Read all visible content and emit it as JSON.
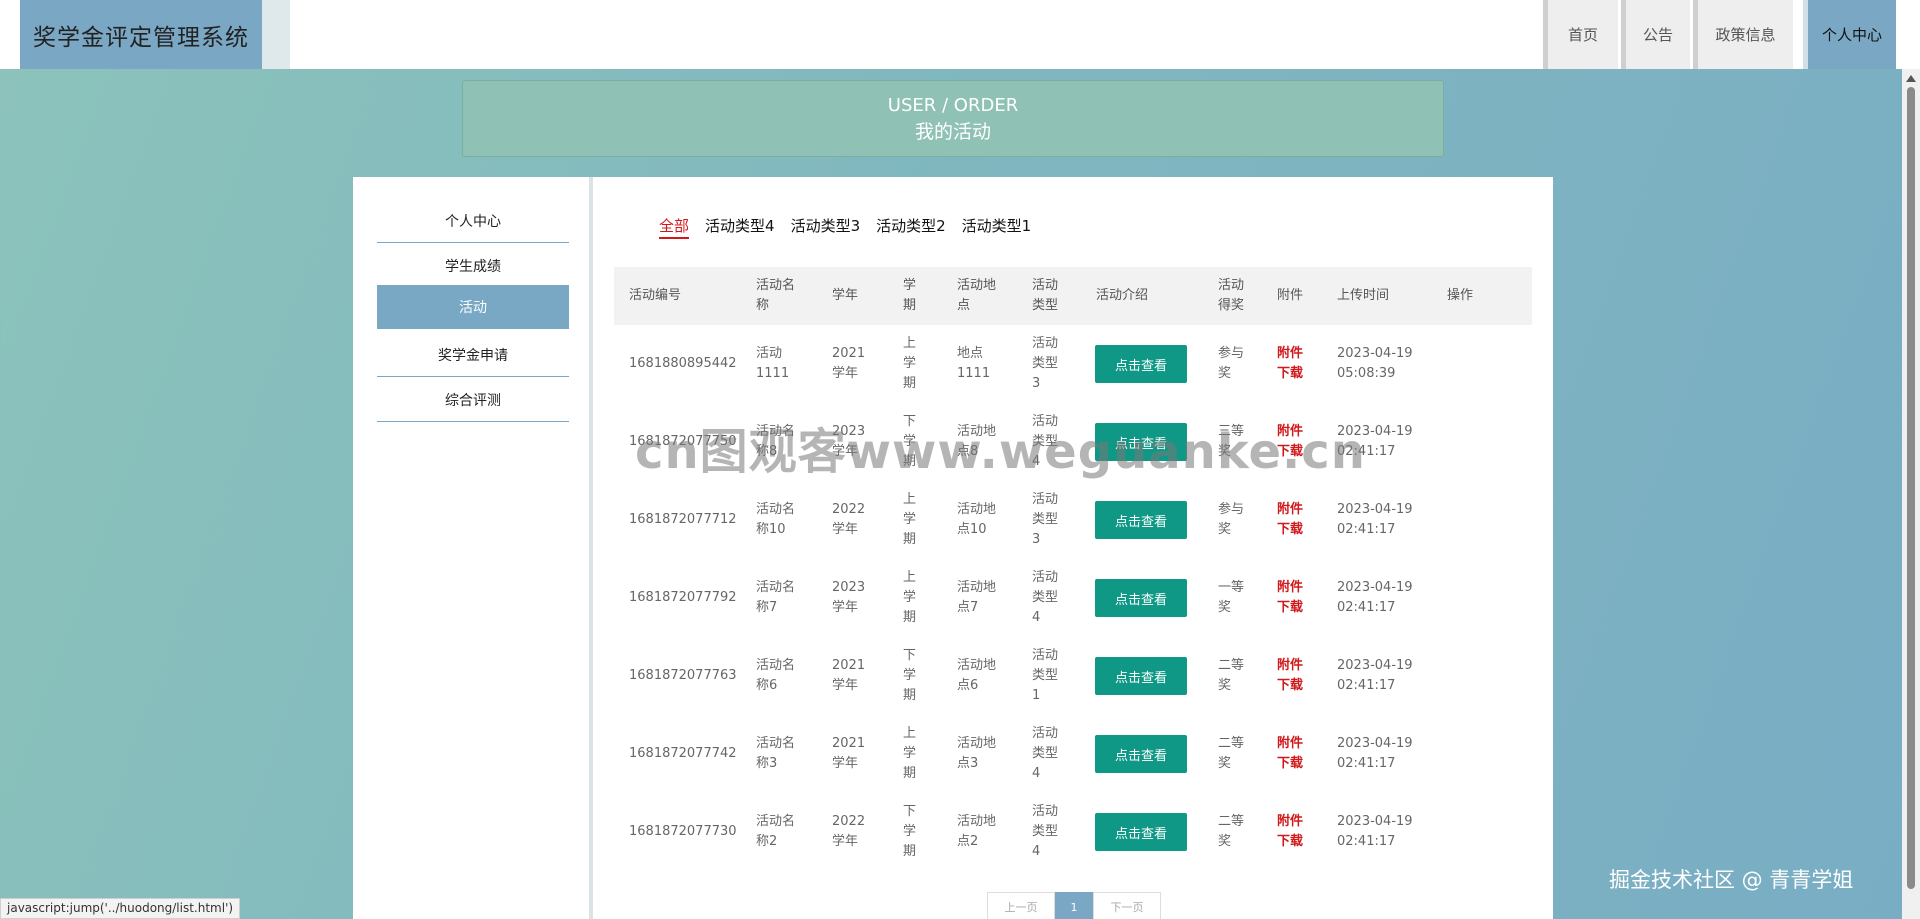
{
  "app_title": "奖学金评定管理系统",
  "nav": {
    "items": [
      {
        "label": "首页"
      },
      {
        "label": "公告"
      },
      {
        "label": "政策信息"
      },
      {
        "label": "个人中心"
      }
    ],
    "active": "个人中心"
  },
  "banner": {
    "en": "USER / ORDER",
    "zh": "我的活动"
  },
  "sidebar": {
    "items": [
      {
        "label": "个人中心"
      },
      {
        "label": "学生成绩"
      },
      {
        "label": "活动"
      },
      {
        "label": "奖学金申请"
      },
      {
        "label": "综合评测"
      }
    ],
    "active": "活动"
  },
  "tabs": [
    {
      "label": "全部"
    },
    {
      "label": "活动类型4"
    },
    {
      "label": "活动类型3"
    },
    {
      "label": "活动类型2"
    },
    {
      "label": "活动类型1"
    }
  ],
  "table": {
    "headers": [
      "活动编号",
      "活动名称",
      "学年",
      "学期",
      "活动地点",
      "活动类型",
      "活动介绍",
      "活动得奖",
      "附件",
      "上传时间",
      "操作"
    ],
    "view_label": "点击查看",
    "download_label": "附件下载",
    "rows": [
      {
        "id": "1681880895442",
        "name": "活动1111",
        "year": "2021学年",
        "term": "上学期",
        "place": "地点1111",
        "type": "活动类型3",
        "award": "参与奖",
        "time": "2023-04-19 05:08:39"
      },
      {
        "id": "1681872077750",
        "name": "活动名称8",
        "year": "2023学年",
        "term": "下学期",
        "place": "活动地点8",
        "type": "活动类型4",
        "award": "三等奖",
        "time": "2023-04-19 02:41:17"
      },
      {
        "id": "1681872077712",
        "name": "活动名称10",
        "year": "2022学年",
        "term": "上学期",
        "place": "活动地点10",
        "type": "活动类型3",
        "award": "参与奖",
        "time": "2023-04-19 02:41:17"
      },
      {
        "id": "1681872077792",
        "name": "活动名称7",
        "year": "2023学年",
        "term": "上学期",
        "place": "活动地点7",
        "type": "活动类型4",
        "award": "一等奖",
        "time": "2023-04-19 02:41:17"
      },
      {
        "id": "1681872077763",
        "name": "活动名称6",
        "year": "2021学年",
        "term": "下学期",
        "place": "活动地点6",
        "type": "活动类型1",
        "award": "二等奖",
        "time": "2023-04-19 02:41:17"
      },
      {
        "id": "1681872077742",
        "name": "活动名称3",
        "year": "2021学年",
        "term": "上学期",
        "place": "活动地点3",
        "type": "活动类型4",
        "award": "二等奖",
        "time": "2023-04-19 02:41:17"
      },
      {
        "id": "1681872077730",
        "name": "活动名称2",
        "year": "2022学年",
        "term": "下学期",
        "place": "活动地点2",
        "type": "活动类型4",
        "award": "二等奖",
        "time": "2023-04-19 02:41:17"
      }
    ]
  },
  "pager": {
    "prev": "上一页",
    "current": "1",
    "next": "下一页"
  },
  "status_url": "javascript:jump('../huodong/list.html')",
  "watermark": "cn图观客www.weguanke.cn",
  "credit": "掘金技术社区 @ 青青学姐"
}
